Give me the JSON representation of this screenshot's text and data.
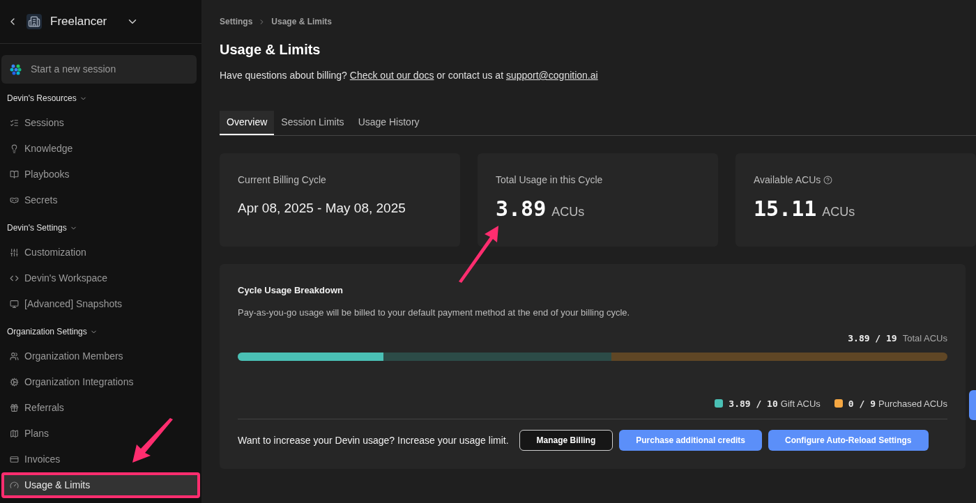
{
  "sidebar": {
    "workspace": "Freelancer",
    "new_session": "Start a new session",
    "sections": [
      {
        "title": "Devin's Resources",
        "items": [
          {
            "label": "Sessions",
            "kind": "list",
            "selected": false
          },
          {
            "label": "Knowledge",
            "kind": "bulb",
            "selected": false
          },
          {
            "label": "Playbooks",
            "kind": "book",
            "selected": false
          },
          {
            "label": "Secrets",
            "kind": "secret",
            "selected": false
          }
        ]
      },
      {
        "title": "Devin's Settings",
        "items": [
          {
            "label": "Customization",
            "kind": "sliders",
            "selected": false
          },
          {
            "label": "Devin's Workspace",
            "kind": "code",
            "selected": false
          },
          {
            "label": "[Advanced] Snapshots",
            "kind": "monitor",
            "selected": false
          }
        ]
      },
      {
        "title": "Organization Settings",
        "items": [
          {
            "label": "Organization Members",
            "kind": "members",
            "selected": false
          },
          {
            "label": "Organization Integrations",
            "kind": "gear",
            "selected": false
          },
          {
            "label": "Referrals",
            "kind": "gift",
            "selected": false
          },
          {
            "label": "Plans",
            "kind": "map",
            "selected": false
          },
          {
            "label": "Invoices",
            "kind": "invoice",
            "selected": false
          },
          {
            "label": "Usage & Limits",
            "kind": "gauge",
            "selected": true
          }
        ]
      }
    ]
  },
  "breadcrumb": [
    "Settings",
    "Usage & Limits"
  ],
  "title": "Usage & Limits",
  "intro": {
    "before": "Have questions about billing?",
    "link": "Check out our docs",
    "middle": "or contact us at",
    "email": "support@cognition.ai"
  },
  "tabs": [
    {
      "label": "Overview",
      "selected": true
    },
    {
      "label": "Session Limits",
      "selected": false
    },
    {
      "label": "Usage History",
      "selected": false
    }
  ],
  "stats": [
    {
      "kind": "text",
      "label": "Current Billing Cycle",
      "value": "Apr 08, 2025 - May 08, 2025"
    },
    {
      "kind": "number",
      "label": "Total Usage in this Cycle",
      "value": "3.89",
      "unit": "ACUs",
      "info": false
    },
    {
      "kind": "number",
      "label": "Available ACUs",
      "value": "15.11",
      "unit": "ACUs",
      "info": true
    }
  ],
  "breakdown": {
    "title": "Cycle Usage Breakdown",
    "description": "Pay-as-you-go usage will be billed to your default payment method at the end of your billing cycle.",
    "total": {
      "value": "3.89 / 19",
      "label": "Total ACUs"
    },
    "bar": {
      "color": "#5f4625",
      "segments": [
        {
          "level": 0.205,
          "color": "#4ac0b5"
        },
        {
          "level": 0.527,
          "color": "#2c4b47"
        }
      ]
    },
    "legend": [
      {
        "value": "3.89 / 10",
        "label": "Gift ACUs",
        "color": "#4ac0b5"
      },
      {
        "value": "0 / 9",
        "label": "Purchased ACUs",
        "color": "#f5a742"
      }
    ],
    "footer": "Want to increase your Devin usage? Increase your usage limit.",
    "buttons": [
      {
        "label": "Manage Billing",
        "kind": "outline"
      },
      {
        "label": "Purchase additional credits",
        "kind": "primary"
      },
      {
        "label": "Configure Auto-Reload Settings",
        "kind": "primary"
      }
    ]
  }
}
